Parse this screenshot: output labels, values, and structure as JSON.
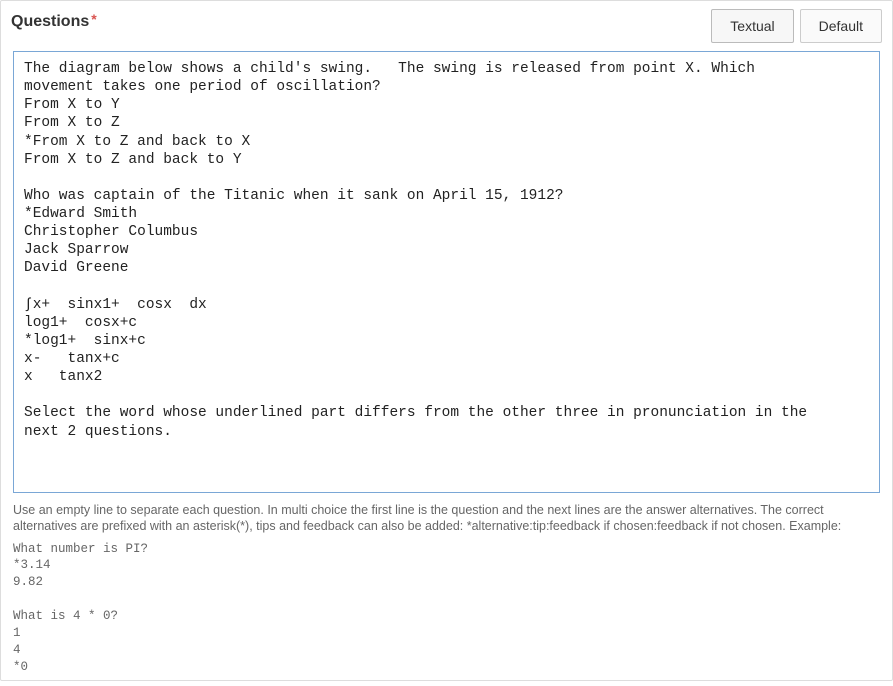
{
  "header": {
    "title": "Questions",
    "required_marker": "*"
  },
  "tabs": {
    "textual": "Textual",
    "default": "Default",
    "active": "textual"
  },
  "questions_text": "The diagram below shows a child's swing.   The swing is released from point X. Which\nmovement takes one period of oscillation?\nFrom X to Y\nFrom X to Z\n*From X to Z and back to X\nFrom X to Z and back to Y\n\nWho was captain of the Titanic when it sank on April 15, 1912?\n*Edward Smith\nChristopher Columbus\nJack Sparrow\nDavid Greene\n\n∫x+  sinx1+  cosx  dx\nlog1+  cosx+c\n*log1+  sinx+c\nx-   tanx+c\nx   tanx2\n\nSelect the word whose underlined part differs from the other three in pronunciation in the\nnext 2 questions.",
  "help": {
    "intro": "Use an empty line to separate each question. In multi choice the first line is the question and the next lines are the answer alternatives. The correct alternatives are prefixed with an asterisk(*), tips and feedback can also be added: *alternative:tip:feedback if chosen:feedback if not chosen. Example:",
    "example": "What number is PI?\n*3.14\n9.82\n\nWhat is 4 * 0?\n1\n4\n*0"
  }
}
